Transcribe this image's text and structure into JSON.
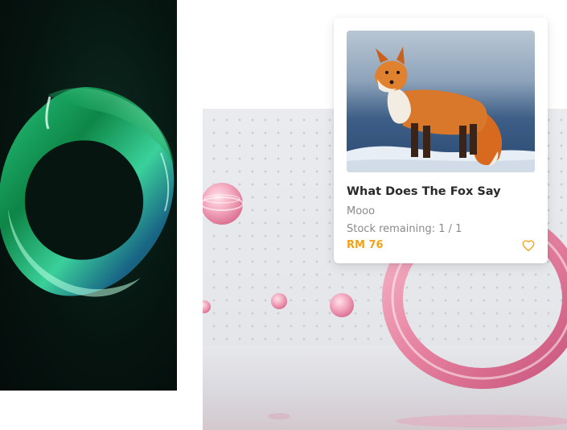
{
  "product": {
    "name": "What Does The Fox Say",
    "description": "Mooo",
    "stock": "Stock remaining: 1 / 1",
    "price": "RM 76",
    "image": "fox-photo",
    "favorite_icon": "heart-outline-icon"
  },
  "colors": {
    "price_accent": "#f2a21a",
    "title_text": "#2a2a2a",
    "muted_text": "#8a8a8a"
  }
}
